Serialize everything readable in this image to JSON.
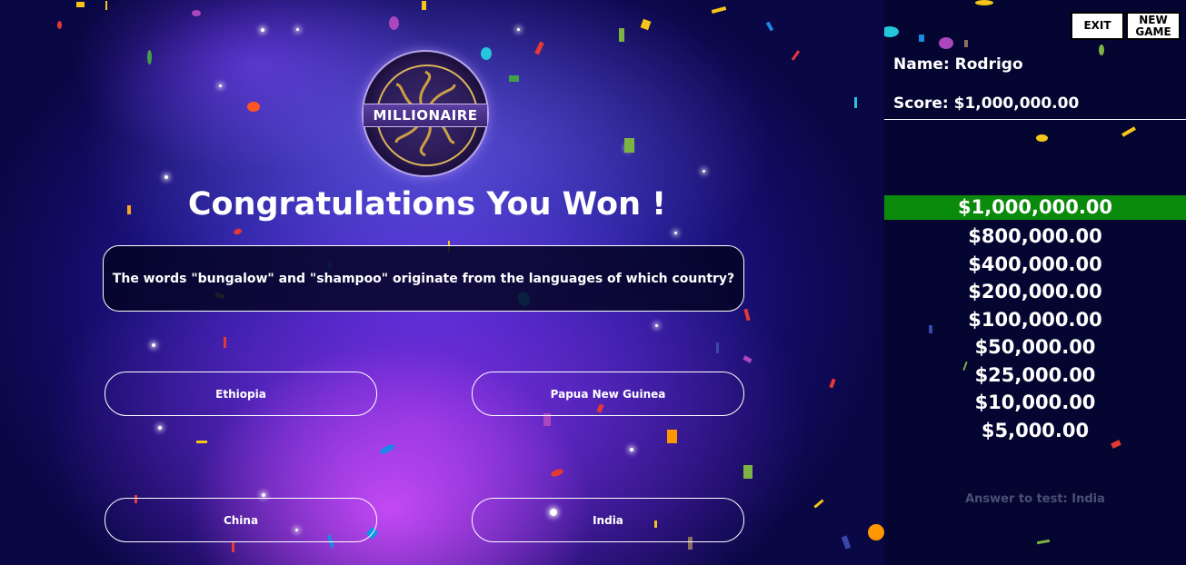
{
  "game": {
    "logo_text": "MILLIONAIRE",
    "headline": "Congratulations You Won !",
    "question": "The words \"bungalow\" and \"shampoo\" originate from the languages of which country?",
    "answers": [
      "Ethiopia",
      "Papua New Guinea",
      "China",
      "India"
    ]
  },
  "panel": {
    "exit_label": "EXIT",
    "new_game_label": "NEW\nGAME",
    "name_text": "Name: Rodrigo",
    "score_text": "Score: $1,000,000.00",
    "prize_ladder": [
      "$1,000,000.00",
      "$800,000.00",
      "$400,000.00",
      "$200,000.00",
      "$100,000.00",
      "$50,000.00",
      "$25,000.00",
      "$10,000.00",
      "$5,000.00"
    ],
    "current_prize_index": 0,
    "answer_hint": "Answer to test:  India"
  },
  "colors": {
    "highlight": "#0a8a0a",
    "panel_bg": "#040530",
    "hint": "#4a4f72"
  }
}
